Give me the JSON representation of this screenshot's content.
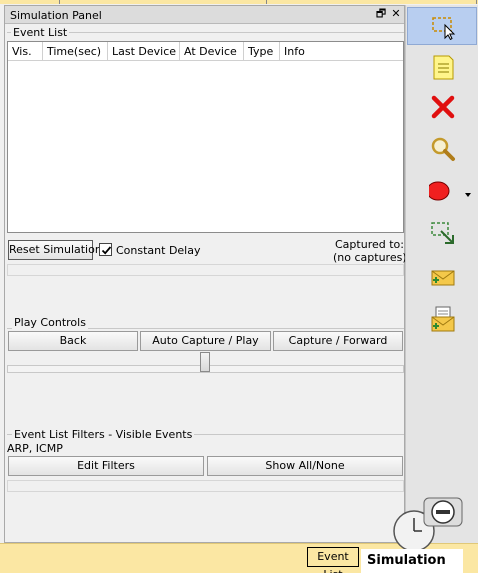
{
  "panel": {
    "title": "Simulation Panel",
    "restore_glyph": "🗗",
    "close_glyph": "✕"
  },
  "event_list": {
    "label": "Event List",
    "columns": [
      "Vis.",
      "Time(sec)",
      "Last Device",
      "At Device",
      "Type",
      "Info"
    ]
  },
  "controls": {
    "reset_label": "Reset Simulation",
    "constant_delay_label": "Constant Delay",
    "constant_delay_checked": true,
    "captured_to_label": "Captured to:",
    "captured_to_value": "(no captures)"
  },
  "play_controls": {
    "label": "Play Controls",
    "back_label": "Back",
    "auto_capture_label": "Auto Capture / Play",
    "capture_forward_label": "Capture / Forward",
    "speed_slider_fraction": 0.5
  },
  "filters": {
    "label": "Event List Filters - Visible Events",
    "visible_events": "ARP, ICMP",
    "edit_label": "Edit Filters",
    "show_all_label": "Show All/None"
  },
  "toolbar": {
    "icons": [
      "select-icon",
      "note-icon",
      "delete-icon",
      "inspect-icon",
      "draw-ellipse-icon",
      "resize-icon",
      "add-simple-pdu-icon",
      "add-complex-pdu-icon"
    ]
  },
  "bottom": {
    "event_list_tab": "Event List",
    "simulation_tab": "Simulation"
  }
}
